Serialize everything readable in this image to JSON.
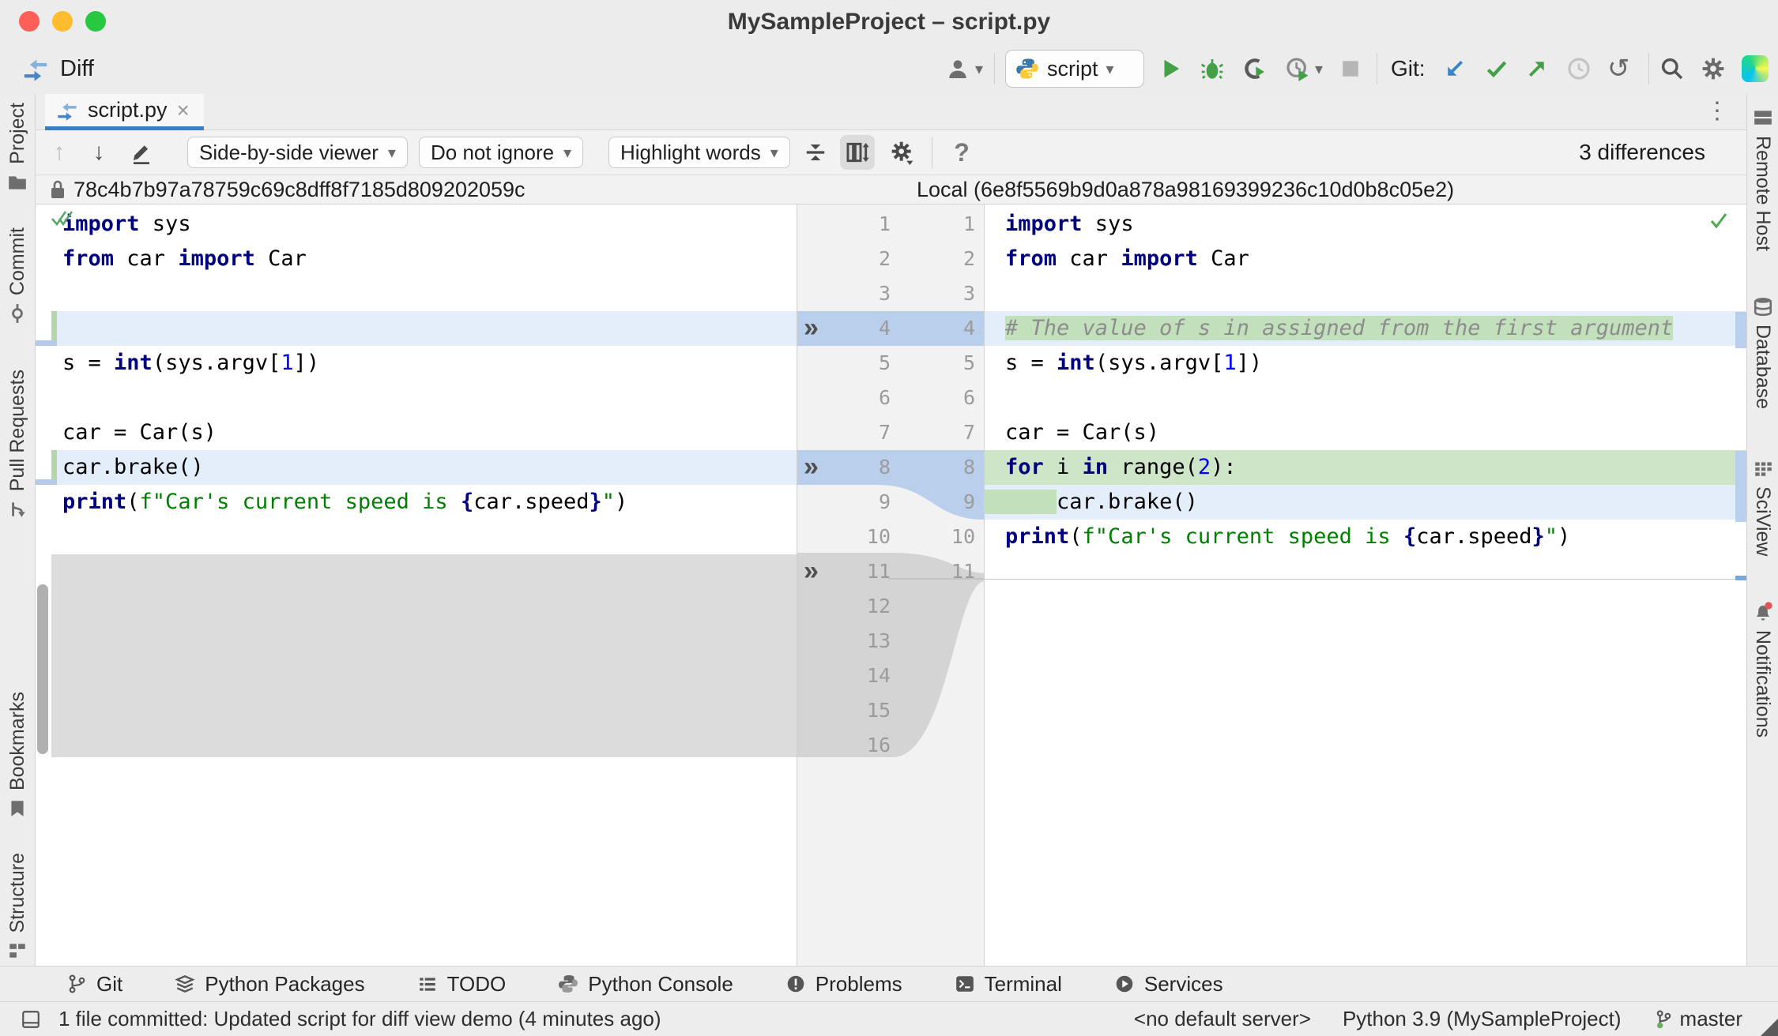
{
  "window": {
    "title": "MySampleProject – script.py"
  },
  "toolbar": {
    "diff_label": "Diff",
    "run_config": "script",
    "git_label": "Git:"
  },
  "tab": {
    "label": "script.py",
    "close": "×",
    "more": "⋮"
  },
  "controls": {
    "viewer": "Side-by-side viewer",
    "ignore": "Do not ignore",
    "highlight": "Highlight words",
    "differences": "3 differences",
    "help": "?",
    "up": "↑",
    "down": "↓"
  },
  "headers": {
    "left": "78c4b7b97a78759c69c8dff8f7185d809202059c",
    "right": "Local (6e8f5569b9d0a878a98169399236c10d0b8c05e2)"
  },
  "stripes": {
    "left": [
      {
        "label": "Project",
        "icon": "folder-icon"
      },
      {
        "label": "Commit",
        "icon": "commit-icon"
      },
      {
        "label": "Pull Requests",
        "icon": "pull-request-icon"
      },
      {
        "label": "Bookmarks",
        "icon": "bookmark-icon"
      },
      {
        "label": "Structure",
        "icon": "structure-icon"
      }
    ],
    "right": [
      {
        "label": "Remote Host",
        "icon": "server-icon"
      },
      {
        "label": "Database",
        "icon": "database-icon"
      },
      {
        "label": "SciView",
        "icon": "grid-icon"
      },
      {
        "label": "Notifications",
        "icon": "bell-icon"
      }
    ]
  },
  "gutter": {
    "left_numbers": [
      "1",
      "2",
      "3",
      "4",
      "5",
      "6",
      "7",
      "8",
      "9",
      "10",
      "11",
      "12",
      "13",
      "14",
      "15",
      "16"
    ],
    "right_numbers": [
      "1",
      "2",
      "3",
      "4",
      "5",
      "6",
      "7",
      "8",
      "9",
      "10",
      "11"
    ],
    "chevron": "»",
    "chevron_rows": [
      4,
      8,
      11
    ]
  },
  "code": {
    "left": [
      {
        "bg": "",
        "segs": [
          {
            "c": "k",
            "t": "import"
          },
          {
            "c": "",
            "t": " sys"
          }
        ]
      },
      {
        "bg": "",
        "segs": [
          {
            "c": "k",
            "t": "from"
          },
          {
            "c": "",
            "t": " car "
          },
          {
            "c": "k",
            "t": "import"
          },
          {
            "c": "",
            "t": " Car"
          }
        ]
      },
      {
        "bg": "",
        "segs": []
      },
      {
        "bg": "changed",
        "segs": []
      },
      {
        "bg": "",
        "segs": [
          {
            "c": "",
            "t": "s = "
          },
          {
            "c": "k",
            "t": "int"
          },
          {
            "c": "",
            "t": "(sys.argv["
          },
          {
            "c": "n",
            "t": "1"
          },
          {
            "c": "",
            "t": "])"
          }
        ]
      },
      {
        "bg": "",
        "segs": []
      },
      {
        "bg": "",
        "segs": [
          {
            "c": "",
            "t": "car = Car(s)"
          }
        ]
      },
      {
        "bg": "changed",
        "segs": [
          {
            "c": "",
            "t": "car.brake()"
          }
        ]
      },
      {
        "bg": "",
        "segs": [
          {
            "c": "k",
            "t": "print"
          },
          {
            "c": "",
            "t": "("
          },
          {
            "c": "s",
            "t": "f\"Car's current speed is "
          },
          {
            "c": "b",
            "t": "{"
          },
          {
            "c": "",
            "t": "car.speed"
          },
          {
            "c": "b",
            "t": "}"
          },
          {
            "c": "s",
            "t": "\""
          },
          {
            "c": "",
            "t": ")"
          }
        ]
      },
      {
        "bg": "",
        "segs": []
      }
    ],
    "right": [
      {
        "bg": "",
        "segs": [
          {
            "c": "k",
            "t": "import"
          },
          {
            "c": "",
            "t": " sys"
          }
        ]
      },
      {
        "bg": "",
        "segs": [
          {
            "c": "k",
            "t": "from"
          },
          {
            "c": "",
            "t": " car "
          },
          {
            "c": "k",
            "t": "import"
          },
          {
            "c": "",
            "t": " Car"
          }
        ]
      },
      {
        "bg": "",
        "segs": []
      },
      {
        "bg": "changedline",
        "segs": [
          {
            "c": "c ins",
            "t": "# The value of s in assigned from the first argument"
          }
        ]
      },
      {
        "bg": "",
        "segs": [
          {
            "c": "",
            "t": "s = "
          },
          {
            "c": "k",
            "t": "int"
          },
          {
            "c": "",
            "t": "(sys.argv["
          },
          {
            "c": "n",
            "t": "1"
          },
          {
            "c": "",
            "t": "])"
          }
        ]
      },
      {
        "bg": "",
        "segs": []
      },
      {
        "bg": "",
        "segs": [
          {
            "c": "",
            "t": "car = Car(s)"
          }
        ]
      },
      {
        "bg": "added",
        "segs": [
          {
            "c": "k",
            "t": "for"
          },
          {
            "c": "",
            "t": " i "
          },
          {
            "c": "k",
            "t": "in"
          },
          {
            "c": "",
            "t": " range("
          },
          {
            "c": "n",
            "t": "2"
          },
          {
            "c": "",
            "t": "):"
          }
        ]
      },
      {
        "bg": "changedline",
        "segs": [
          {
            "c": "ins lead",
            "t": "    "
          },
          {
            "c": "",
            "t": "car.brake()"
          }
        ]
      },
      {
        "bg": "",
        "segs": [
          {
            "c": "k",
            "t": "print"
          },
          {
            "c": "",
            "t": "("
          },
          {
            "c": "s",
            "t": "f\"Car's current speed is "
          },
          {
            "c": "b",
            "t": "{"
          },
          {
            "c": "",
            "t": "car.speed"
          },
          {
            "c": "b",
            "t": "}"
          },
          {
            "c": "s",
            "t": "\""
          },
          {
            "c": "",
            "t": ")"
          }
        ]
      },
      {
        "bg": "",
        "segs": []
      }
    ]
  },
  "bottom_bar": [
    {
      "label": "Git",
      "icon": "git-branch-icon"
    },
    {
      "label": "Python Packages",
      "icon": "layers-icon"
    },
    {
      "label": "TODO",
      "icon": "todo-list-icon"
    },
    {
      "label": "Python Console",
      "icon": "python-icon"
    },
    {
      "label": "Problems",
      "icon": "problems-icon"
    },
    {
      "label": "Terminal",
      "icon": "terminal-icon"
    },
    {
      "label": "Services",
      "icon": "services-icon"
    }
  ],
  "status_bar": {
    "message": "1 file committed: Updated script for diff view demo (4 minutes ago)",
    "server": "<no default server>",
    "interpreter": "Python 3.9 (MySampleProject)",
    "branch": "master"
  },
  "colors": {
    "accent_blue": "#3d7ebd",
    "changed_row": "#e4eefa",
    "added_row": "#cfe5c8",
    "inserted_word": "#c3e0bd",
    "deleted_gray": "#dcdcdc",
    "gutter_changed": "#b9cfec",
    "keyword": "#000080",
    "string": "#008000",
    "number": "#0000ff",
    "comment": "#8c8c8c"
  }
}
